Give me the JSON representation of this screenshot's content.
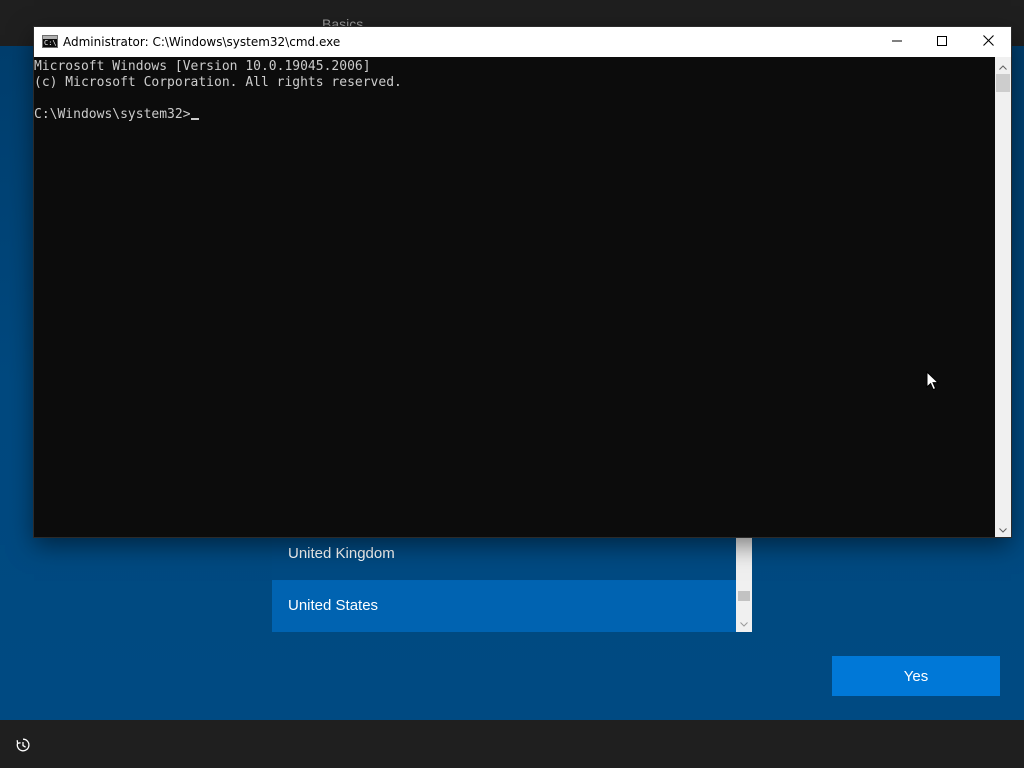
{
  "oobe": {
    "section_title": "Basics",
    "region_list": {
      "items": [
        {
          "label": "United Kingdom",
          "selected": false
        },
        {
          "label": "United States",
          "selected": true
        }
      ]
    },
    "yes_button_label": "Yes",
    "accessibility_icon": "accessibility-icon"
  },
  "cmd": {
    "title": "Administrator: C:\\Windows\\system32\\cmd.exe",
    "icon_text": "C:\\",
    "console_lines": [
      "Microsoft Windows [Version 10.0.19045.2006]",
      "(c) Microsoft Corporation. All rights reserved.",
      "",
      "C:\\Windows\\system32>"
    ],
    "controls": {
      "minimize_icon": "minimize-icon",
      "maximize_icon": "maximize-icon",
      "close_icon": "close-icon"
    }
  },
  "colors": {
    "console_bg": "#0c0c0c",
    "console_text": "#cccccc",
    "oobe_bg": "#004a82",
    "selected_item": "#0063b1",
    "accent_button": "#0078d7"
  }
}
